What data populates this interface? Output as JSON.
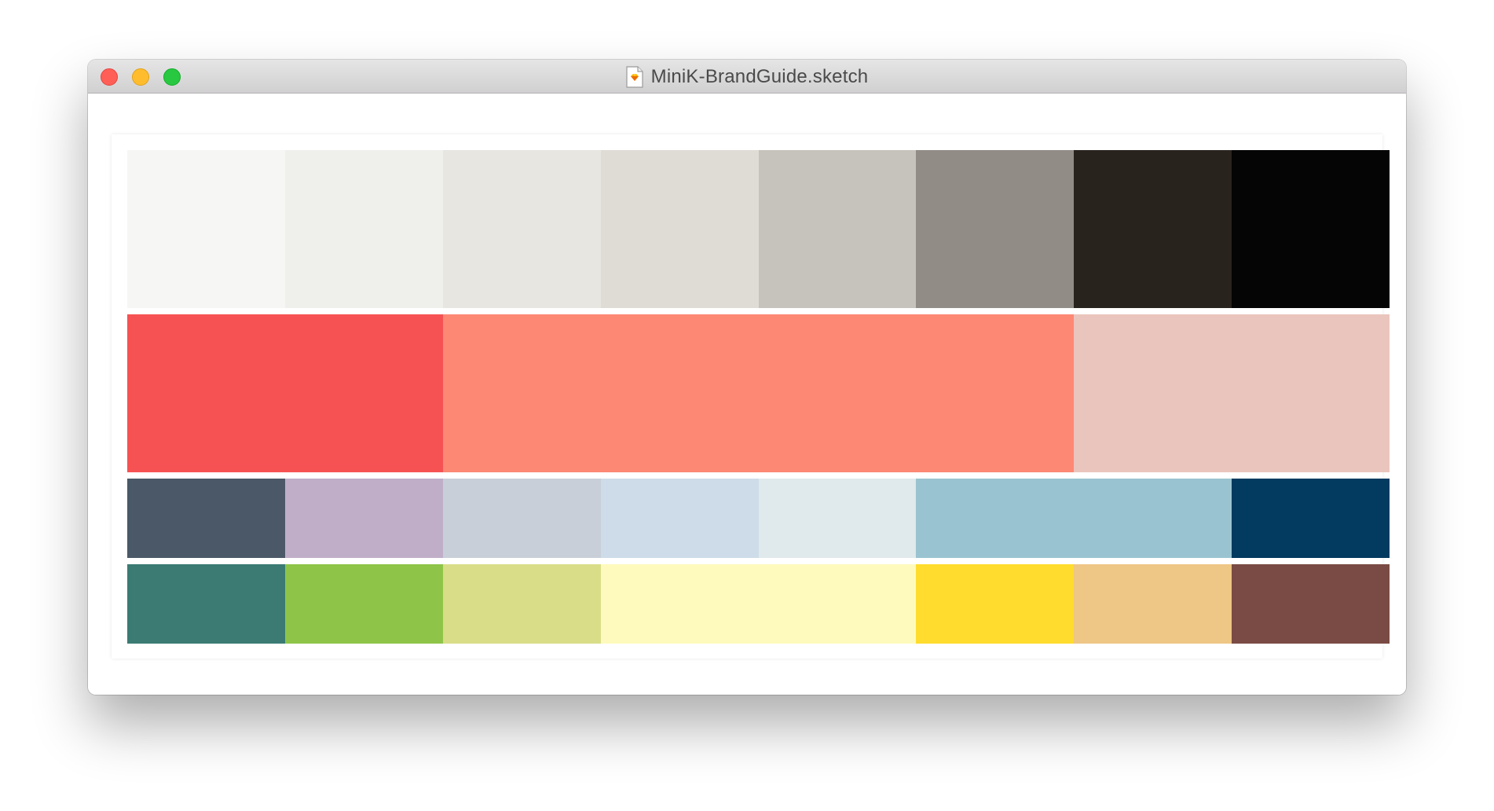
{
  "window": {
    "title": "MiniK-BrandGuide.sketch",
    "title_icon": "sketch-document-icon",
    "controls": {
      "close": "close-button",
      "minimize": "minimize-button",
      "maximize": "maximize-button"
    }
  },
  "palette": {
    "row1": [
      "#f6f6f4",
      "#efefeb",
      "#e7e6e1",
      "#dfdcd6",
      "#c6c3bd",
      "#918c86",
      "#29231e",
      "#060505"
    ],
    "row2": [
      "#f65253",
      "#fd8874",
      "#eac5bd"
    ],
    "row3": [
      "#4a5867",
      "#c0aec8",
      "#c8cfd8",
      "#cddce8",
      "#e0e9eb",
      "#9ac3d1",
      "#033a60"
    ],
    "row4": [
      "#3b7b73",
      "#8ec549",
      "#d9dd88",
      "#fefabd",
      "#ffdc2d",
      "#eec685",
      "#7a4b44"
    ]
  }
}
